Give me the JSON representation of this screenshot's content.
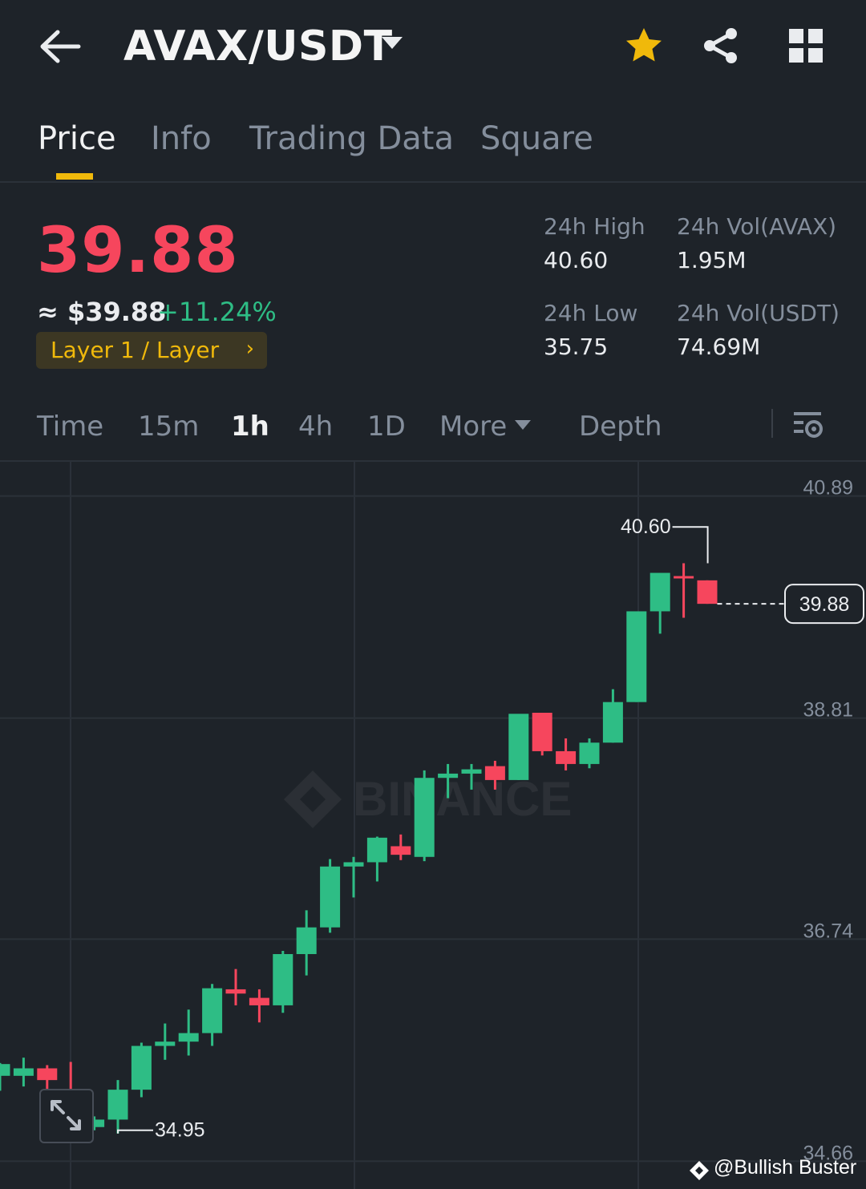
{
  "header": {
    "pair": "AVAX/USDT",
    "icons": [
      "back-arrow-icon",
      "chevron-down-icon",
      "star-icon",
      "share-icon",
      "grid-icon"
    ]
  },
  "tabs": [
    {
      "label": "Price",
      "active": true
    },
    {
      "label": "Info"
    },
    {
      "label": "Trading Data"
    },
    {
      "label": "Square"
    }
  ],
  "ticker": {
    "last_price": "39.88",
    "usd_price": "≈ $39.88",
    "change_pct": "+11.24%",
    "tag": "Layer 1 / Layer",
    "stats": {
      "high_label": "24h High",
      "high_value": "40.60",
      "vol_base_label": "24h Vol(AVAX)",
      "vol_base_value": "1.95M",
      "low_label": "24h Low",
      "low_value": "35.75",
      "vol_quote_label": "24h Vol(USDT)",
      "vol_quote_value": "74.69M"
    }
  },
  "intervals": {
    "items": [
      "Time",
      "15m",
      "1h",
      "4h",
      "1D"
    ],
    "active": "1h",
    "more": "More",
    "depth": "Depth"
  },
  "colors": {
    "up": "#2ebd85",
    "down": "#f6465d",
    "accent": "#f0b90b",
    "background": "#1e2329"
  },
  "chart_data": {
    "type": "candlestick",
    "interval": "1h",
    "y_ticks": [
      "40.89",
      "38.81",
      "36.74",
      "34.66"
    ],
    "ylim": [
      34.4,
      41.21
    ],
    "high_marker": "40.60",
    "low_marker": "34.95",
    "last_price_label": "39.88",
    "watermark": "BINANCE",
    "candles": [
      {
        "o": 35.46,
        "h": 35.58,
        "l": 35.32,
        "c": 35.57
      },
      {
        "o": 35.46,
        "h": 35.63,
        "l": 35.36,
        "c": 35.53
      },
      {
        "o": 35.53,
        "h": 35.56,
        "l": 35.18,
        "c": 35.42
      },
      {
        "o": 35.31,
        "h": 35.59,
        "l": 35.21,
        "c": 35.14
      },
      {
        "o": 34.98,
        "h": 35.08,
        "l": 34.95,
        "c": 35.05
      },
      {
        "o": 35.05,
        "h": 35.42,
        "l": 34.92,
        "c": 35.33
      },
      {
        "o": 35.33,
        "h": 35.77,
        "l": 35.26,
        "c": 35.74
      },
      {
        "o": 35.74,
        "h": 35.95,
        "l": 35.61,
        "c": 35.78
      },
      {
        "o": 35.78,
        "h": 36.08,
        "l": 35.65,
        "c": 35.86
      },
      {
        "o": 35.86,
        "h": 36.32,
        "l": 35.74,
        "c": 36.28
      },
      {
        "o": 36.27,
        "h": 36.46,
        "l": 36.12,
        "c": 36.23
      },
      {
        "o": 36.19,
        "h": 36.27,
        "l": 35.96,
        "c": 36.12
      },
      {
        "o": 36.12,
        "h": 36.63,
        "l": 36.05,
        "c": 36.6
      },
      {
        "o": 36.6,
        "h": 37.01,
        "l": 36.4,
        "c": 36.85
      },
      {
        "o": 36.85,
        "h": 37.49,
        "l": 36.8,
        "c": 37.42
      },
      {
        "o": 37.42,
        "h": 37.51,
        "l": 37.13,
        "c": 37.46
      },
      {
        "o": 37.46,
        "h": 37.7,
        "l": 37.28,
        "c": 37.69
      },
      {
        "o": 37.61,
        "h": 37.72,
        "l": 37.48,
        "c": 37.53
      },
      {
        "o": 37.51,
        "h": 38.32,
        "l": 37.47,
        "c": 38.25
      },
      {
        "o": 38.25,
        "h": 38.38,
        "l": 38.06,
        "c": 38.29
      },
      {
        "o": 38.29,
        "h": 38.38,
        "l": 38.14,
        "c": 38.33
      },
      {
        "o": 38.36,
        "h": 38.41,
        "l": 38.14,
        "c": 38.23
      },
      {
        "o": 38.23,
        "h": 38.81,
        "l": 38.23,
        "c": 38.85
      },
      {
        "o": 38.86,
        "h": 38.86,
        "l": 38.46,
        "c": 38.5
      },
      {
        "o": 38.5,
        "h": 38.62,
        "l": 38.32,
        "c": 38.38
      },
      {
        "o": 38.38,
        "h": 38.62,
        "l": 38.34,
        "c": 38.58
      },
      {
        "o": 38.58,
        "h": 39.08,
        "l": 38.58,
        "c": 38.96
      },
      {
        "o": 38.96,
        "h": 39.8,
        "l": 38.96,
        "c": 39.81
      },
      {
        "o": 39.81,
        "h": 40.17,
        "l": 39.6,
        "c": 40.17
      },
      {
        "o": 40.14,
        "h": 40.26,
        "l": 39.75,
        "c": 40.13
      },
      {
        "o": 40.1,
        "h": 40.1,
        "l": 39.88,
        "c": 39.88
      }
    ]
  },
  "footer": {
    "watermark": "@Bullish Buster"
  }
}
